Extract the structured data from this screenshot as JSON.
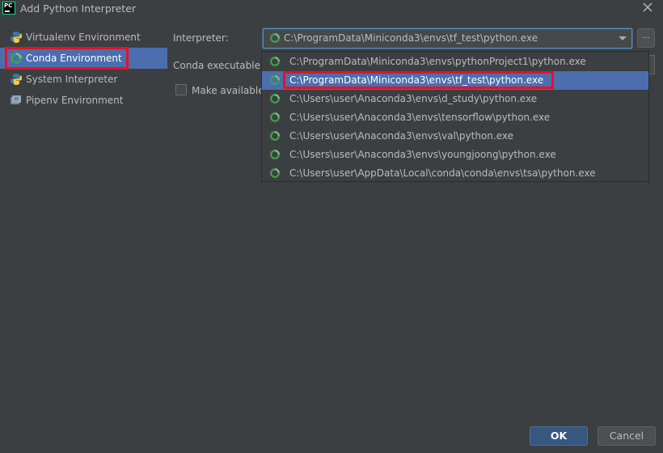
{
  "window": {
    "logo_text": "PC",
    "title": "Add Python Interpreter"
  },
  "sidebar": {
    "items": [
      {
        "label": "Virtualenv Environment",
        "icon": "python-icon"
      },
      {
        "label": "Conda Environment",
        "icon": "conda-icon",
        "selected": true
      },
      {
        "label": "System Interpreter",
        "icon": "python-icon"
      },
      {
        "label": "Pipenv Environment",
        "icon": "pipenv-icon"
      }
    ]
  },
  "form": {
    "interpreter_label": "Interpreter:",
    "interpreter_value": "C:\\ProgramData\\Miniconda3\\envs\\tf_test\\python.exe",
    "browse_label": "...",
    "conda_exe_label": "Conda executable:",
    "make_available_label": "Make available t"
  },
  "dropdown": {
    "options": [
      "C:\\ProgramData\\Miniconda3\\envs\\pythonProject1\\python.exe",
      "C:\\ProgramData\\Miniconda3\\envs\\tf_test\\python.exe",
      "C:\\Users\\user\\Anaconda3\\envs\\d_study\\python.exe",
      "C:\\Users\\user\\Anaconda3\\envs\\tensorflow\\python.exe",
      "C:\\Users\\user\\Anaconda3\\envs\\val\\python.exe",
      "C:\\Users\\user\\Anaconda3\\envs\\youngjoong\\python.exe",
      "C:\\Users\\user\\AppData\\Local\\conda\\conda\\envs\\tsa\\python.exe"
    ],
    "selected_index": 1
  },
  "buttons": {
    "ok": "OK",
    "cancel": "Cancel"
  },
  "colors": {
    "background": "#3c3f41",
    "selection": "#4b6eaf",
    "highlight_box": "#e81123",
    "conda_icon": "#3fa34d"
  }
}
